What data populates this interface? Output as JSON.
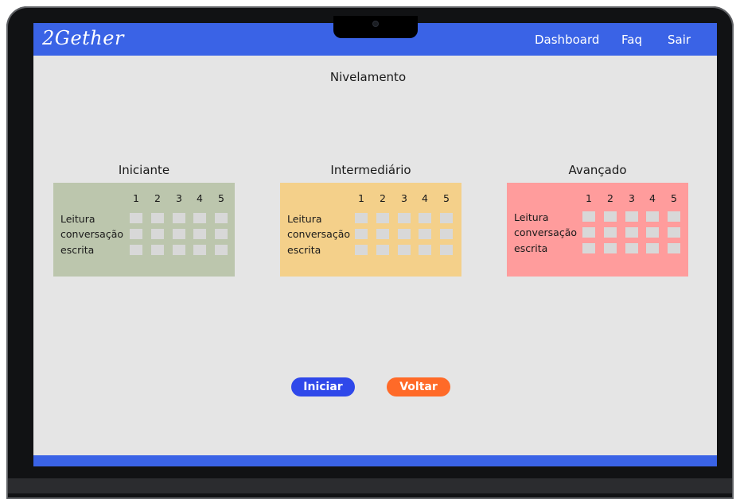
{
  "app": {
    "logo": "2Gether"
  },
  "nav": {
    "dashboard": "Dashboard",
    "faq": "Faq",
    "sair": "Sair"
  },
  "page": {
    "title": "Nivelamento"
  },
  "levels": [
    {
      "title": "Iniciante",
      "color": "#bcc6ad"
    },
    {
      "title": "Intermediário",
      "color": "#f4d08a"
    },
    {
      "title": "Avançado",
      "color": "#ff9c9c"
    }
  ],
  "scale": [
    "1",
    "2",
    "3",
    "4",
    "5"
  ],
  "skills": [
    "Leitura",
    "conversação",
    "escrita"
  ],
  "buttons": {
    "start": "Iniciar",
    "back": "Voltar"
  },
  "colors": {
    "nav": "#3a63e6",
    "start_button": "#2f48ea",
    "back_button": "#ff6a28"
  }
}
